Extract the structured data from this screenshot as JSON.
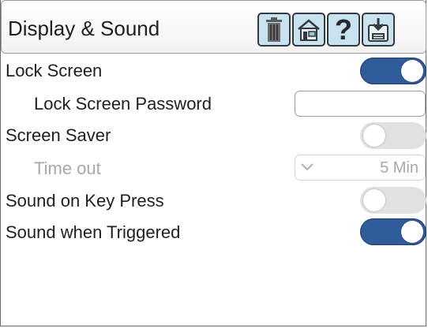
{
  "header": {
    "title": "Display & Sound",
    "buttons": [
      {
        "icon": "trash-icon"
      },
      {
        "icon": "house-icon"
      },
      {
        "icon": "help-icon",
        "glyph": "?"
      },
      {
        "icon": "save-icon"
      }
    ]
  },
  "settings": {
    "lock_screen": {
      "label": "Lock Screen",
      "enabled": true
    },
    "lock_password": {
      "label": "Lock Screen Password",
      "value": "",
      "placeholder": ""
    },
    "screen_saver": {
      "label": "Screen Saver",
      "enabled": false
    },
    "time_out": {
      "label": "Time out",
      "value": "5 Min",
      "disabled": true
    },
    "sound_key_press": {
      "label": "Sound on Key Press",
      "enabled": false
    },
    "sound_triggered": {
      "label": "Sound when Triggered",
      "enabled": true
    }
  },
  "colors": {
    "toggle_on": "#2f5d9b",
    "toggle_off": "#e1e1e1",
    "tool_button_bg": "#c8e2ef",
    "disabled_text": "#a8a8a8"
  }
}
